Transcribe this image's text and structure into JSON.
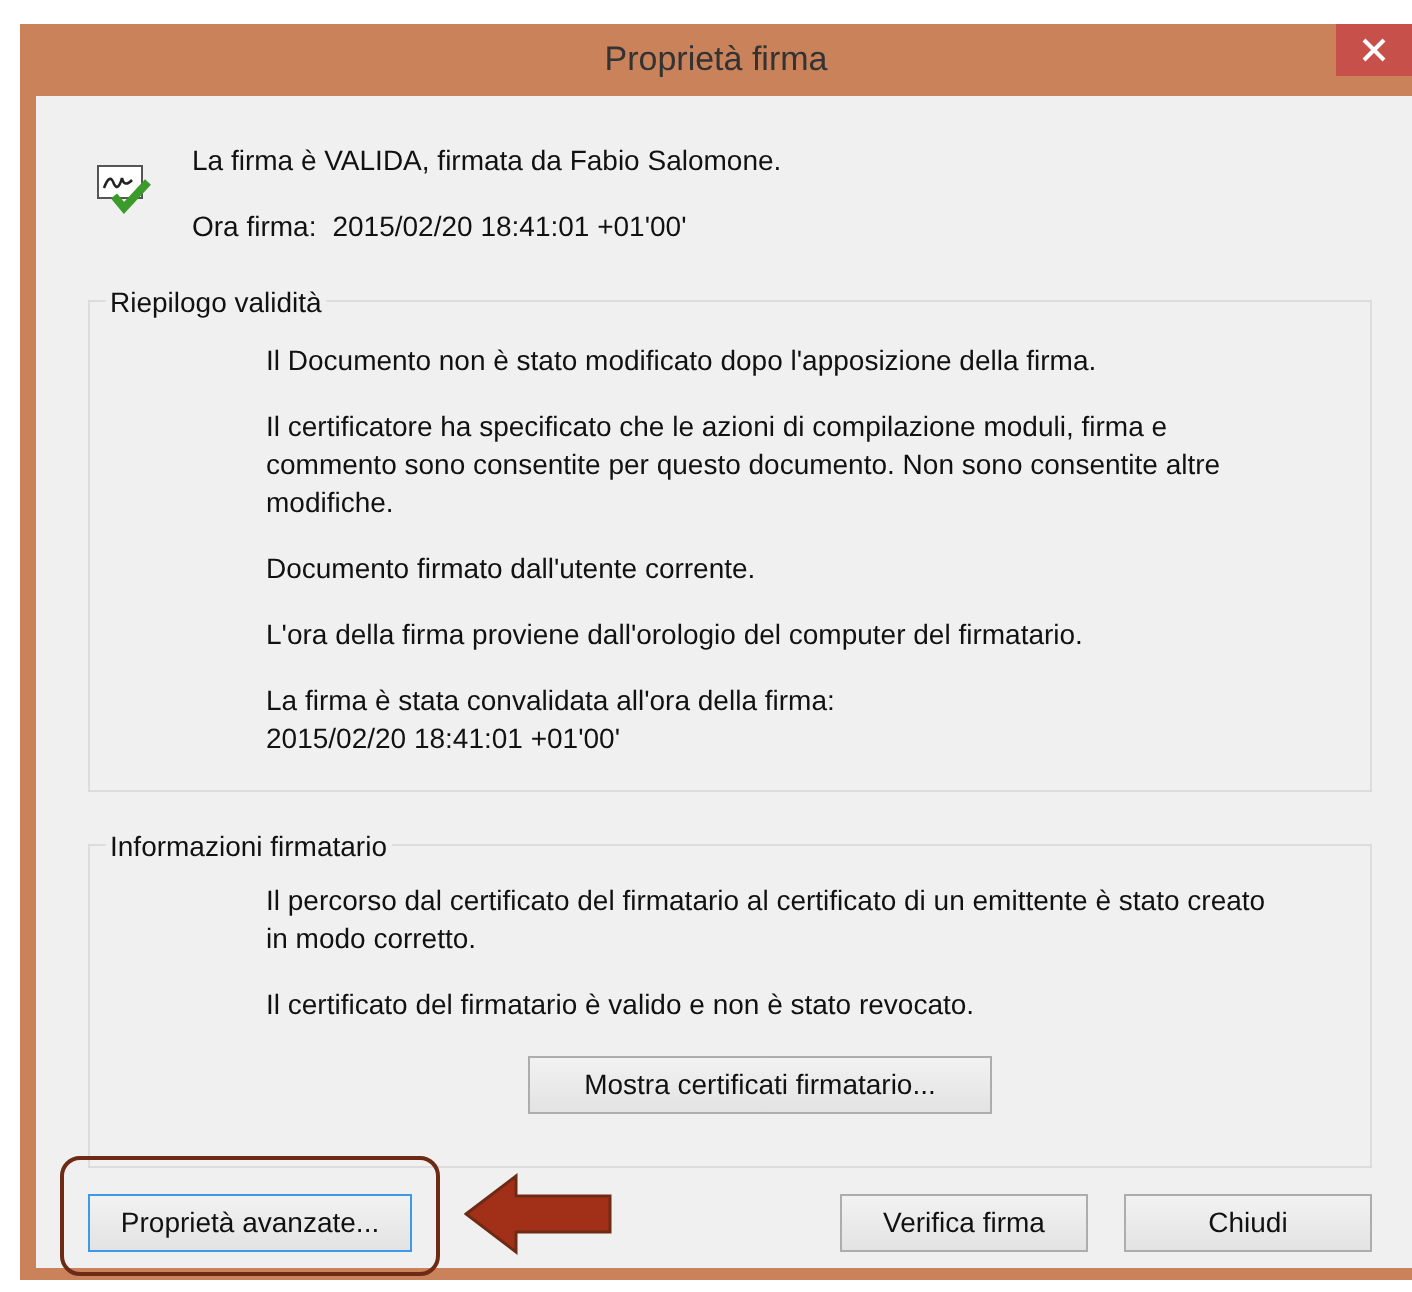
{
  "window": {
    "title": "Proprietà firma"
  },
  "summary": {
    "status": "La firma è VALIDA, firmata da Fabio Salomone.",
    "time_label": "Ora firma:",
    "time_value": "2015/02/20 18:41:01 +01'00'"
  },
  "groups": [
    {
      "legend": "Riepilogo validità",
      "paragraphs": [
        "Il Documento non è stato modificato dopo l'apposizione della firma.",
        "Il certificatore ha specificato che le azioni di compilazione moduli, firma e commento sono consentite per questo documento. Non sono consentite altre modifiche.",
        "Documento firmato dall'utente corrente.",
        "L'ora della firma proviene dall'orologio del computer del firmatario.",
        "La firma è stata convalidata all'ora della firma:\n2015/02/20 18:41:01 +01'00'"
      ]
    },
    {
      "legend": "Informazioni firmatario",
      "paragraphs": [
        "Il percorso dal certificato del firmatario al certificato di un emittente è stato creato in modo corretto.",
        "Il certificato del firmatario è valido e non è stato revocato."
      ],
      "button": "Mostra certificati firmatario..."
    }
  ],
  "buttons": [
    {
      "label": "Proprietà avanzate...",
      "focused": true,
      "highlighted": true
    },
    {
      "label": "Verifica firma",
      "focused": false,
      "highlighted": false
    },
    {
      "label": "Chiudi",
      "focused": false,
      "highlighted": false
    }
  ]
}
